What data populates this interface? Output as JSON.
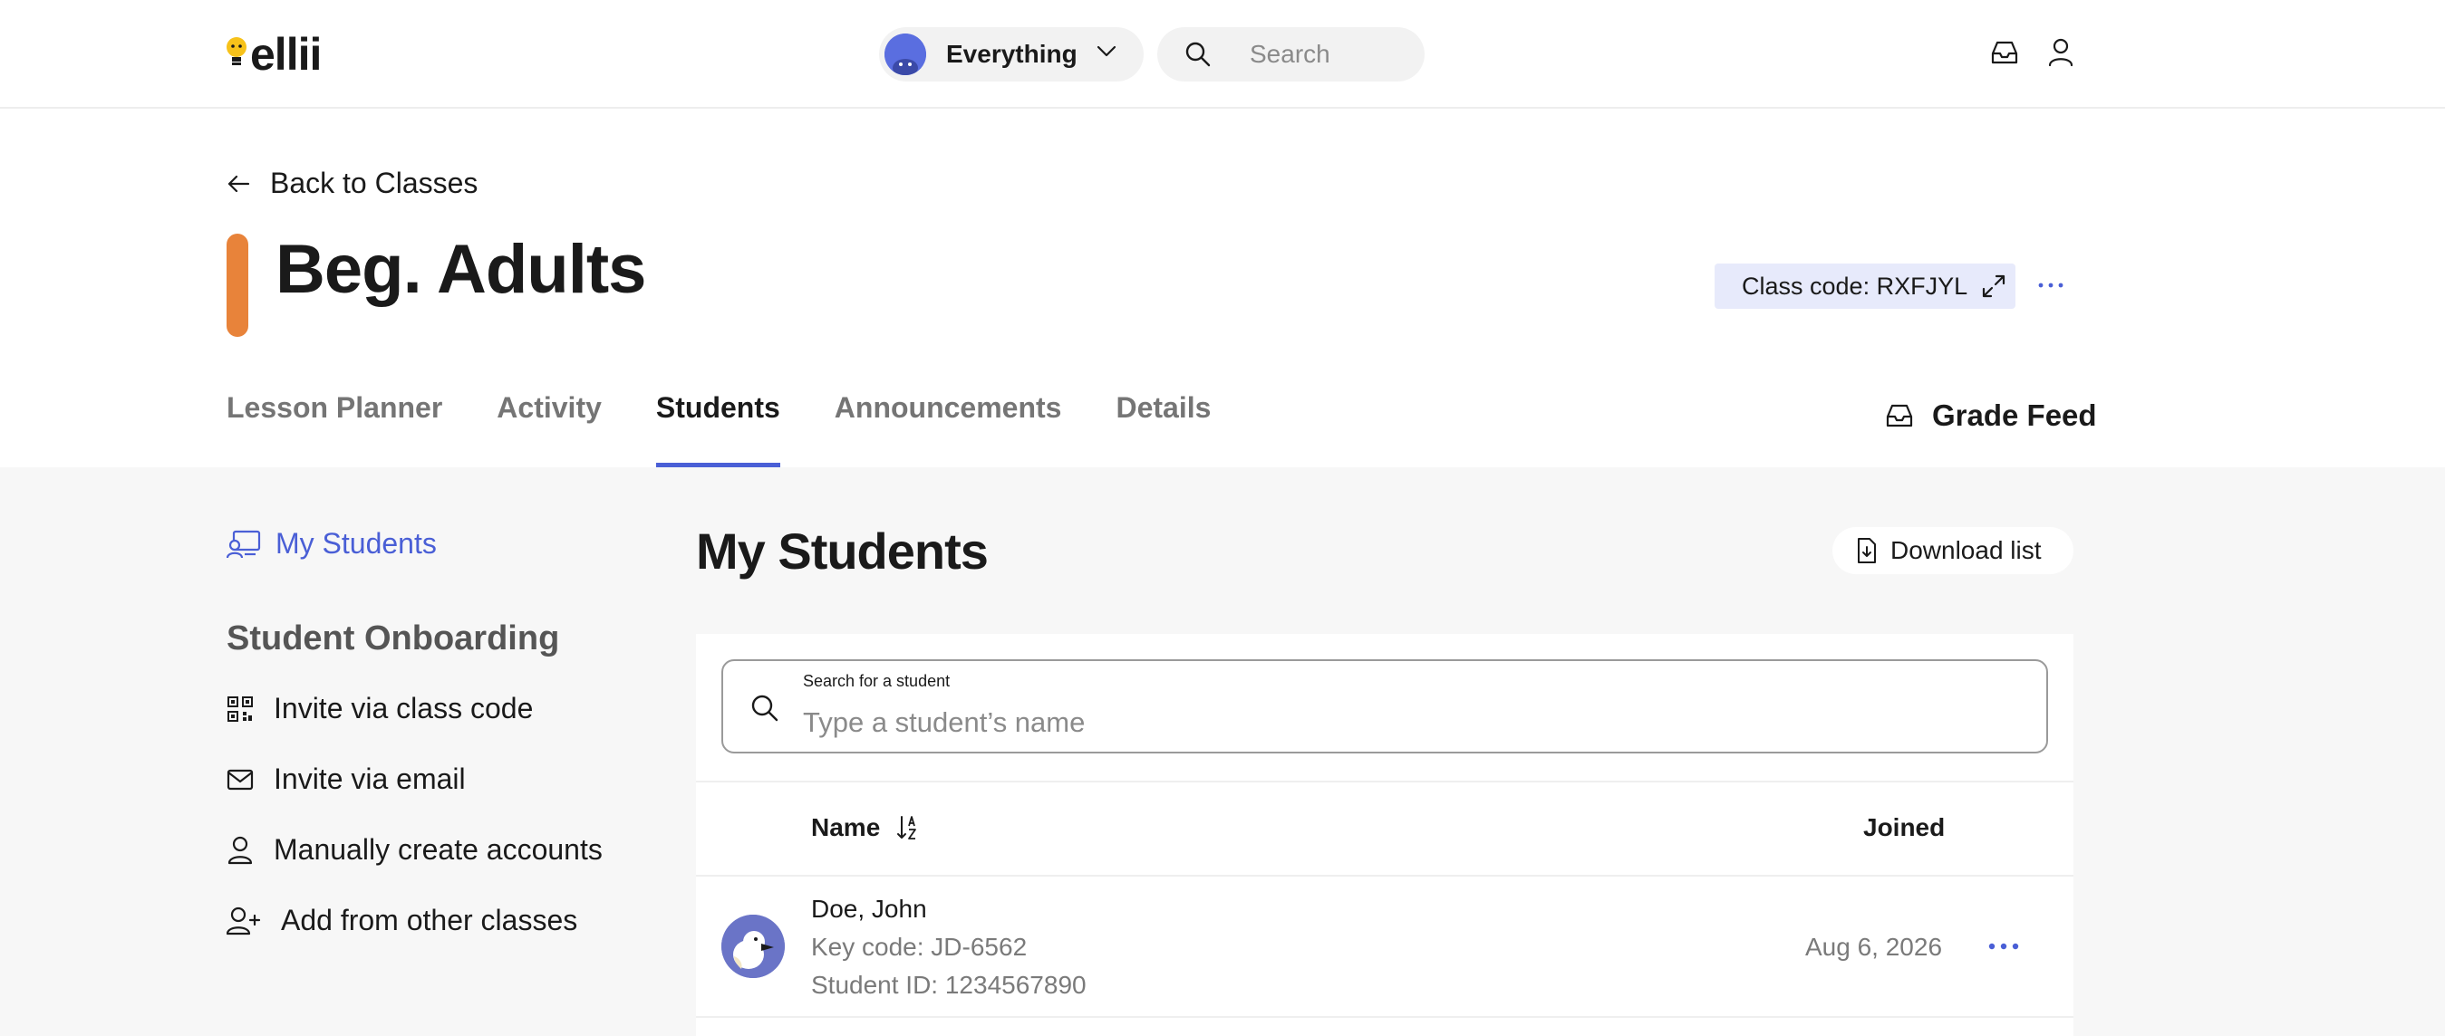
{
  "app": {
    "logo_text": "ellii",
    "scope_label": "Everything",
    "search_placeholder": "Search"
  },
  "header": {
    "back_label": "Back to Classes",
    "class_title": "Beg. Adults",
    "class_code_label": "Class code: RXFJYL",
    "class_color": "#e8833a"
  },
  "tabs": [
    {
      "label": "Lesson Planner",
      "active": false
    },
    {
      "label": "Activity",
      "active": false
    },
    {
      "label": "Students",
      "active": true
    },
    {
      "label": "Announcements",
      "active": false
    },
    {
      "label": "Details",
      "active": false
    }
  ],
  "grade_feed_label": "Grade Feed",
  "sidebar": {
    "active_item": "My Students",
    "section_heading": "Student Onboarding",
    "items": [
      {
        "label": "Invite via class code",
        "icon": "qr-code-icon"
      },
      {
        "label": "Invite via email",
        "icon": "envelope-icon"
      },
      {
        "label": "Manually create accounts",
        "icon": "person-icon"
      },
      {
        "label": "Add from other classes",
        "icon": "person-add-icon"
      }
    ]
  },
  "main": {
    "title": "My Students",
    "download_label": "Download list",
    "search_label": "Search for a student",
    "search_placeholder": "Type a student’s name",
    "columns": {
      "name": "Name",
      "joined": "Joined"
    },
    "students": [
      {
        "name": "Doe, John",
        "key_code": "Key code: JD-6562",
        "student_id": "Student ID: 1234567890",
        "joined": "Aug 6, 2026"
      }
    ]
  },
  "colors": {
    "accent": "#4a5fd6",
    "class_code_bg": "#e7eafb",
    "content_bg": "#f7f7f7"
  }
}
